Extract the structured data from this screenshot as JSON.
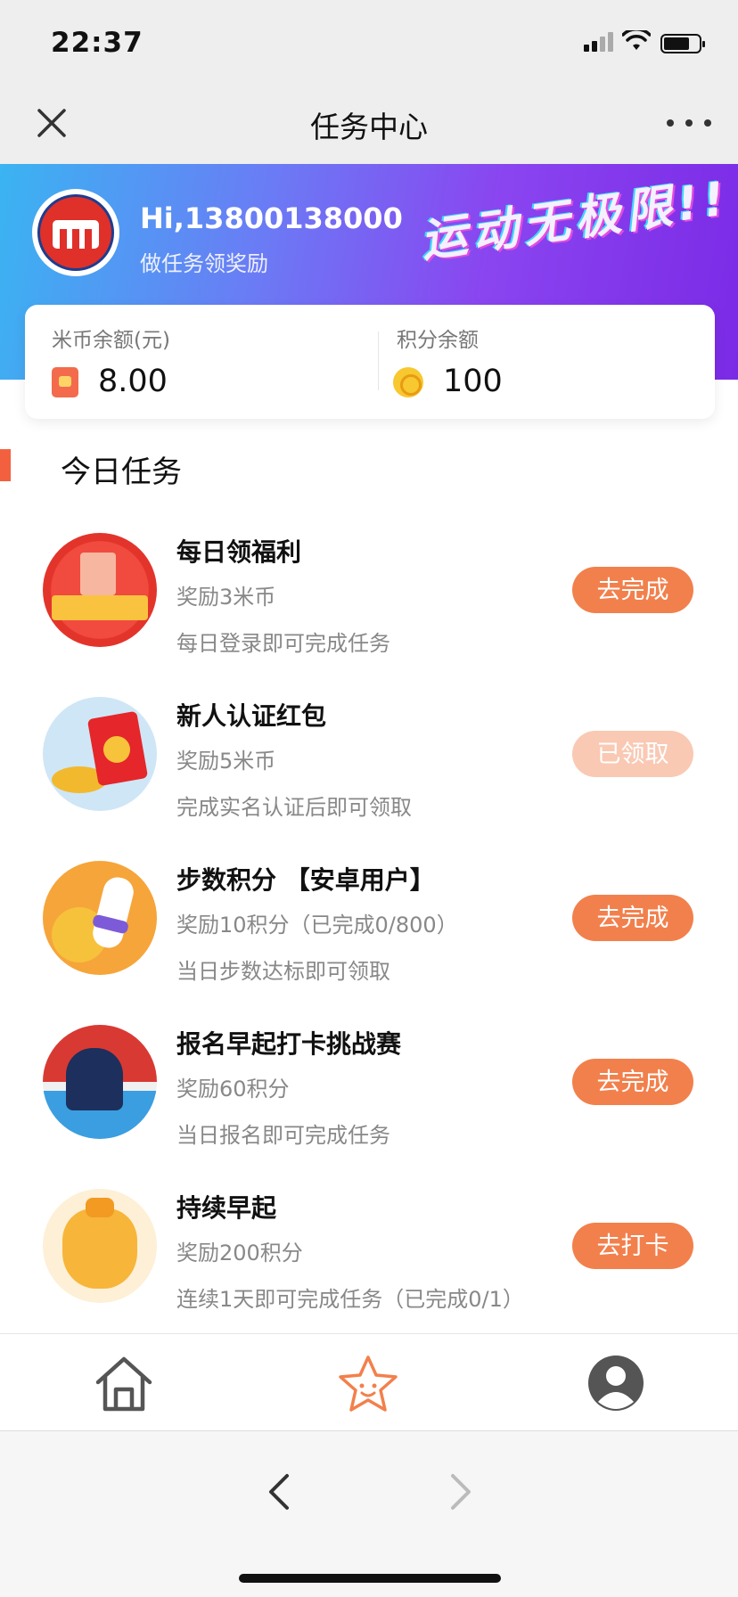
{
  "status_bar": {
    "time": "22:37"
  },
  "nav": {
    "title": "任务中心"
  },
  "header": {
    "greeting": "Hi,13800138000",
    "subtitle": "做任务领奖励",
    "slogan": "运动无极限!!",
    "brand_color": "#e0302a"
  },
  "balance": {
    "coins_label": "米币余额(元)",
    "coins_value": "8.00",
    "points_label": "积分余额",
    "points_value": "100"
  },
  "tasks_section": {
    "title": "今日任务"
  },
  "tasks": [
    {
      "icon": "sign-in-icon",
      "title": "每日领福利",
      "reward": "奖励3米币",
      "desc": "每日登录即可完成任务",
      "button": "去完成",
      "status": "pending"
    },
    {
      "icon": "red-packet-icon",
      "title": "新人认证红包",
      "reward": "奖励5米币",
      "desc": "完成实名认证后即可领取",
      "button": "已领取",
      "status": "claimed"
    },
    {
      "icon": "runner-icon",
      "title": "步数积分 【安卓用户】",
      "reward": "奖励10积分（已完成0/800）",
      "desc": "当日步数达标即可领取",
      "button": "去完成",
      "status": "pending"
    },
    {
      "icon": "early-rise-icon",
      "title": "报名早起打卡挑战赛",
      "reward": "奖励60积分",
      "desc": "当日报名即可完成任务",
      "button": "去完成",
      "status": "pending"
    },
    {
      "icon": "money-bag-icon",
      "title": "持续早起",
      "reward": "奖励200积分",
      "desc": "连续1天即可完成任务（已完成0/1）",
      "button": "去打卡",
      "status": "pending"
    }
  ],
  "tab_bar": {
    "items": [
      "home-icon",
      "star-icon",
      "profile-icon"
    ],
    "active": "star-icon",
    "active_color": "#f2804c"
  },
  "colors": {
    "accent": "#f2804c",
    "claimed": "#f9c9b4",
    "section_mark": "#f3603f"
  }
}
